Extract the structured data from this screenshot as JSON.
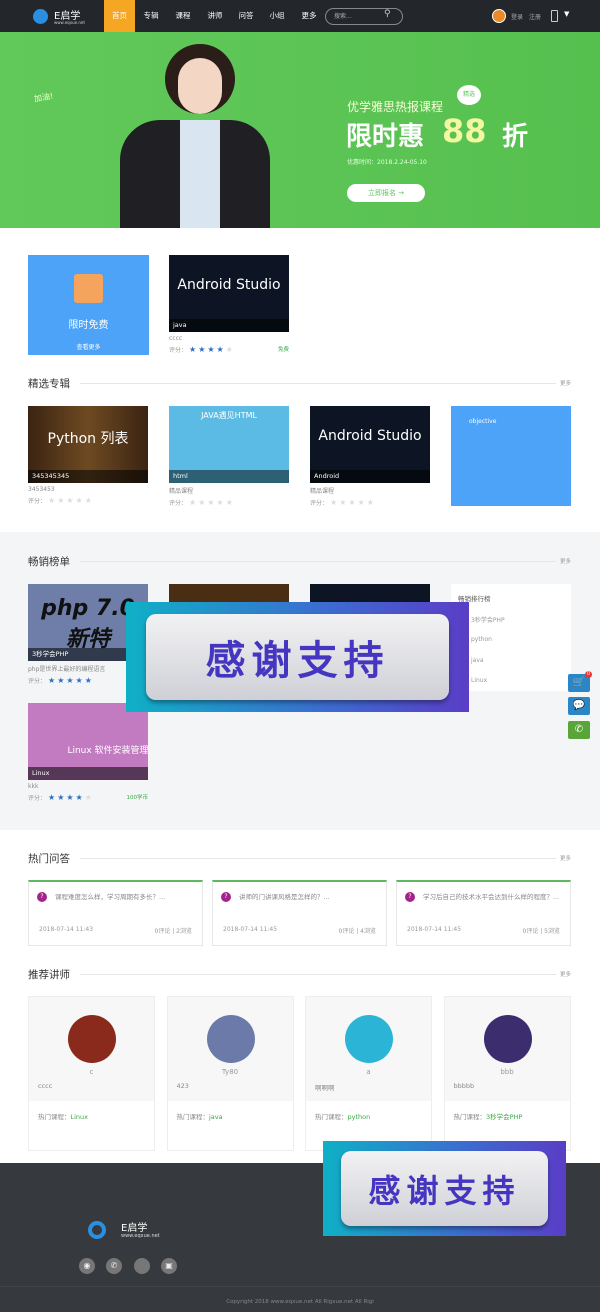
{
  "nav": {
    "logo_text": "E启学",
    "logo_url_text": "www.eqxue.net",
    "items": [
      "首页",
      "专辑",
      "课程",
      "讲师",
      "问答",
      "小组",
      "更多"
    ],
    "active": "首页",
    "search_placeholder": "搜索...",
    "login": "登录",
    "register": "注册"
  },
  "banner": {
    "subtitle": "优学雅思热报课程",
    "badge": "精选",
    "headline": "限时惠",
    "discount": "88",
    "discount_unit": "折",
    "period": "优惠时间：2018.2.24-05.10",
    "cta": "立即报名 →",
    "hand_text": "加油!"
  },
  "free": {
    "tile_label": "限时免费",
    "tile_more": "查看更多",
    "course": {
      "image_text": "Android Studio",
      "tag": "java",
      "title": "cccc",
      "rating": 4,
      "price": "免费"
    }
  },
  "rating_label": "评分：",
  "featured": {
    "title": "精选专辑",
    "more": "更多",
    "cards": [
      {
        "image_text": "Python 列表",
        "tag": "345345345",
        "title": "3453453",
        "rating": 0
      },
      {
        "image_text": "JAVA遇见HTML",
        "tag": "html",
        "title": "精品课程",
        "rating": 0
      },
      {
        "image_text": "Android Studio",
        "tag": "Android",
        "title": "精品课程",
        "rating": 0
      },
      {
        "image_text": "objective"
      }
    ]
  },
  "bestseller": {
    "title": "畅销榜单",
    "more": "更多",
    "cards": [
      {
        "image_text": "php 7.0 新特",
        "tag": "3秒学会PHP",
        "title": "php是世界上最好的编程语言",
        "rating": 5
      },
      {
        "image_text": "Linux 软件安装管理",
        "tag": "Linux",
        "title": "kkk",
        "rating": 4,
        "price": "100学币"
      }
    ],
    "ranking": {
      "title": "畅销排行榜",
      "items": [
        "3秒学会PHP",
        "python",
        "java",
        "Linux"
      ]
    }
  },
  "qa": {
    "title": "热门问答",
    "more": "更多",
    "items": [
      {
        "question": "课程难度怎么样，学习周期有多长？...",
        "time": "2018-07-14 11:43",
        "comments": "0评论",
        "views": "2浏览"
      },
      {
        "question": "讲师的门讲课风格是怎样的？...",
        "time": "2018-07-14 11:45",
        "comments": "0评论",
        "views": "4浏览"
      },
      {
        "question": "学习后自己的技术水平会达到什么样的程度？...",
        "time": "2018-07-14 11:45",
        "comments": "0评论",
        "views": "5浏览"
      }
    ]
  },
  "teachers": {
    "title": "推荐讲师",
    "more": "更多",
    "hot_label": "热门课程：",
    "items": [
      {
        "name": "c",
        "desc": "cccc",
        "course": "Linux",
        "color": "#8a2a1c"
      },
      {
        "name": "Ty80",
        "desc": "423",
        "course": "java",
        "color": "#6b7aa8"
      },
      {
        "name": "a",
        "desc": "啊啊啊",
        "course": "python",
        "color": "#2bb4d6"
      },
      {
        "name": "bbb",
        "desc": "bbbbb",
        "course": "3秒学会PHP",
        "color": "#3b2d6e"
      }
    ]
  },
  "overlay_text": "感谢支持",
  "side": {
    "cart_count": "0"
  },
  "footer": {
    "logo_text": "E启学",
    "logo_url_text": "www.eqxue.net",
    "copyright": "Copyright 2018 www.eqxue.net All Rigxue.net All Rigi"
  },
  "colors": {
    "nav_bg": "#23262b",
    "accent": "#f5a623",
    "banner": "#5cc85a",
    "blue_tile": "#4da3f7",
    "star": "#2e6fbd",
    "green_text": "#3aa845"
  }
}
